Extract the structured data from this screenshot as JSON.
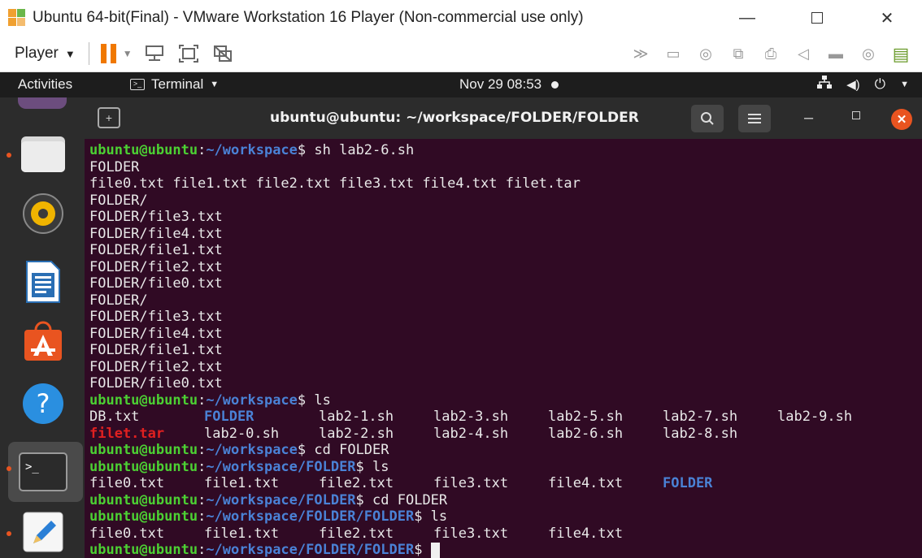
{
  "vmware": {
    "title": "Ubuntu 64-bit(Final) - VMware Workstation 16 Player (Non-commercial use only)",
    "player_menu": "Player"
  },
  "ubuntu": {
    "activities": "Activities",
    "app_menu": "Terminal",
    "clock": "Nov 29  08:53"
  },
  "terminal": {
    "title": "ubuntu@ubuntu: ~/workspace/FOLDER/FOLDER",
    "prompt_user": "ubuntu@ubuntu",
    "sep": ":",
    "path_ws": "~/workspace",
    "path_f": "~/workspace/FOLDER",
    "path_ff": "~/workspace/FOLDER/FOLDER",
    "dollar": "$ ",
    "cmd1": "sh lab2-6.sh",
    "output1": [
      "FOLDER",
      "file0.txt file1.txt file2.txt file3.txt file4.txt filet.tar",
      "FOLDER/",
      "FOLDER/file3.txt",
      "FOLDER/file4.txt",
      "FOLDER/file1.txt",
      "FOLDER/file2.txt",
      "FOLDER/file0.txt",
      "FOLDER/",
      "FOLDER/file3.txt",
      "FOLDER/file4.txt",
      "FOLDER/file1.txt",
      "FOLDER/file2.txt",
      "FOLDER/file0.txt"
    ],
    "cmd2": "ls",
    "ls1_row1": [
      "DB.txt",
      "FOLDER",
      "lab2-1.sh",
      "lab2-3.sh",
      "lab2-5.sh",
      "lab2-7.sh",
      "lab2-9.sh"
    ],
    "ls1_row2": [
      "filet.tar",
      "lab2-0.sh",
      "lab2-2.sh",
      "lab2-4.sh",
      "lab2-6.sh",
      "lab2-8.sh"
    ],
    "cmd3": "cd FOLDER",
    "cmd4": "ls",
    "ls2": [
      "file0.txt",
      "file1.txt",
      "file2.txt",
      "file3.txt",
      "file4.txt",
      "FOLDER"
    ],
    "cmd5": "cd FOLDER",
    "cmd6": "ls",
    "ls3": [
      "file0.txt",
      "file1.txt",
      "file2.txt",
      "file3.txt",
      "file4.txt"
    ]
  },
  "icons": {
    "dock": [
      "files-icon",
      "rhythmbox-icon",
      "writer-icon",
      "software-icon",
      "help-icon",
      "terminal-icon",
      "text-editor-icon"
    ],
    "toolbar": [
      "send-ctrl-alt-del-icon",
      "fit-guest-icon",
      "unity-icon"
    ],
    "status": [
      "network-icon",
      "volume-icon",
      "power-icon"
    ]
  },
  "colors": {
    "terminal_bg": "#300a24",
    "prompt_user": "#4cd033",
    "prompt_path": "#4a82d6",
    "archive": "#e02020",
    "accent": "#e95420",
    "pause": "#f07800"
  }
}
